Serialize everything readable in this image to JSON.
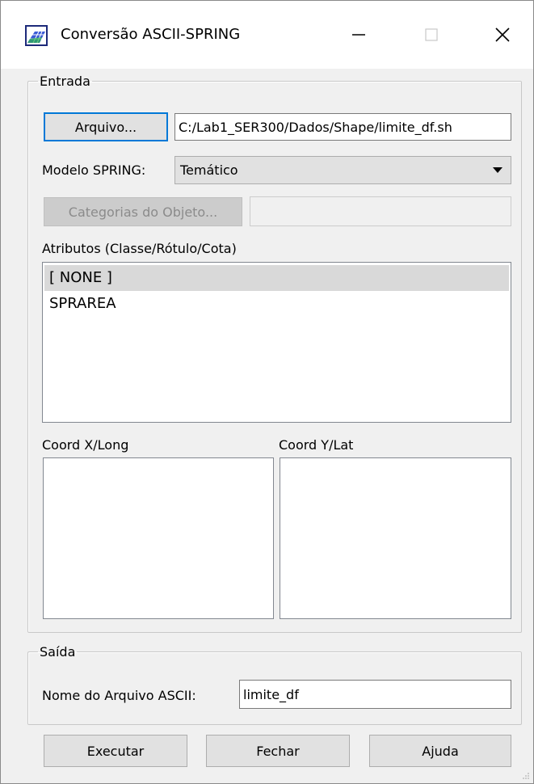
{
  "window": {
    "title": "Conversão ASCII-SPRING",
    "app_icon": "spring-grid-icon",
    "minimize_icon": "minimize-icon",
    "maximize_icon": "maximize-icon",
    "close_icon": "close-icon"
  },
  "entrada": {
    "legend": "Entrada",
    "arquivo_button": "Arquivo...",
    "arquivo_path": "C:/Lab1_SER300/Dados/Shape/limite_df.sh",
    "modelo_label": "Modelo SPRING:",
    "modelo_value": "Temático",
    "categorias_button": "Categorias do Objeto...",
    "categorias_value": "",
    "atributos_label": "Atributos (Classe/Rótulo/Cota)",
    "atributos_items": [
      "[ NONE ]",
      "SPRAREA"
    ],
    "atributos_selected_index": 0,
    "coord_x_label": "Coord X/Long",
    "coord_y_label": "Coord Y/Lat"
  },
  "saida": {
    "legend": "Saída",
    "nome_label": "Nome do Arquivo ASCII:",
    "nome_value": "limite_df"
  },
  "buttons": {
    "executar": "Executar",
    "fechar": "Fechar",
    "ajuda": "Ajuda"
  },
  "colors": {
    "focus_border": "#0078d7",
    "selected_row": "#d9d9d9",
    "window_bg": "#f0f0f0"
  }
}
